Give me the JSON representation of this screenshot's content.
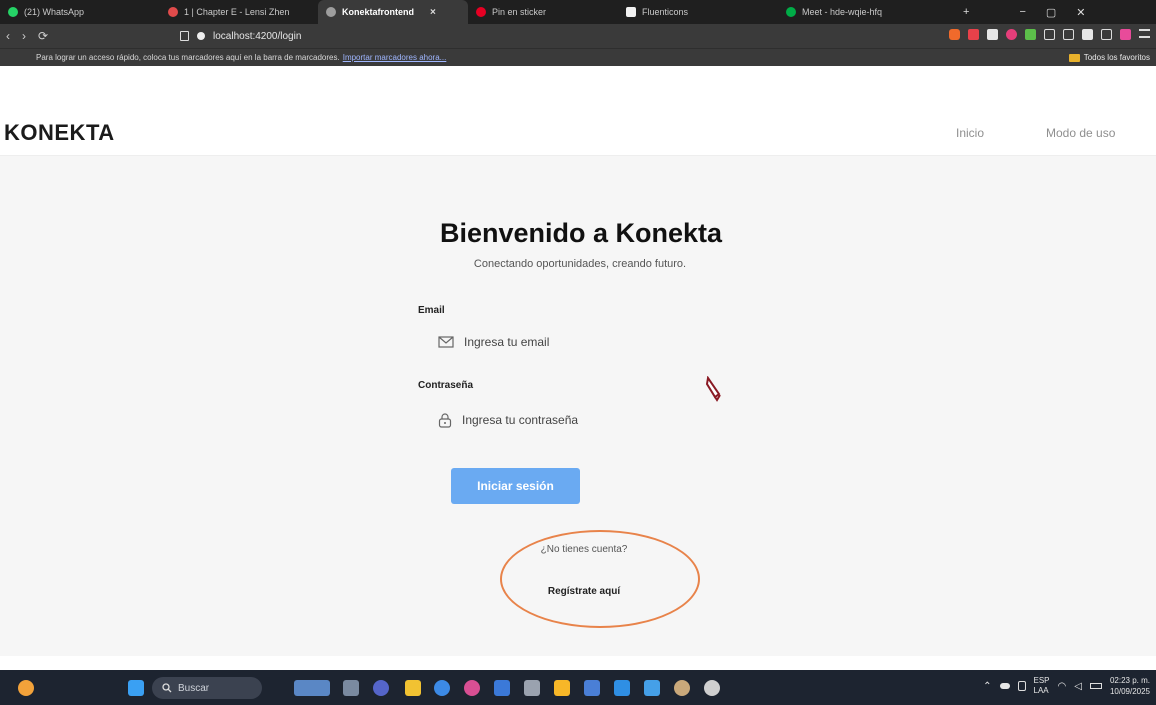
{
  "browser": {
    "tabs": [
      {
        "label": "(21) WhatsApp",
        "color": "#25d366"
      },
      {
        "label": "1 | Chapter E - Lensi Zhen",
        "color": "#e04b4b"
      },
      {
        "label": "Konektafrontend",
        "color": "#9e9e9e",
        "active": true
      },
      {
        "label": "Pin en sticker",
        "color": "#e60023"
      },
      {
        "label": "Fluenticons",
        "color": "#f1f1f1"
      },
      {
        "label": "Meet - hde-wqie-hfq",
        "color": "#00ac47"
      }
    ],
    "tab_close": "×",
    "new_tab": "+",
    "win_min": "−",
    "win_max": "▢",
    "win_close": "✕",
    "nav_back": "‹",
    "nav_forward": "›",
    "nav_reload": "⟳",
    "url": "localhost:4200/login",
    "bookmarks_hint": "Para lograr un acceso rápido, coloca tus marcadores aquí en la barra de marcadores.",
    "bookmarks_import": "Importar marcadores ahora...",
    "bookmarks_all": "Todos los favoritos"
  },
  "app": {
    "logo": "KONEKTA",
    "nav": {
      "inicio": "Inicio",
      "modo_de_uso": "Modo de uso"
    },
    "title": "Bienvenido a Konekta",
    "subtitle": "Conectando oportunidades, creando futuro.",
    "email_label": "Email",
    "email_placeholder": "Ingresa tu email",
    "password_label": "Contraseña",
    "password_placeholder": "Ingresa tu contraseña",
    "login_button": "Iniciar sesión",
    "no_account": "¿No tienes cuenta?",
    "register_link": "Regístrate aquí",
    "accent_color": "#6aaaf2",
    "highlight_color": "#e8834a"
  },
  "taskbar": {
    "search_placeholder": "Buscar",
    "lang_top": "ESP",
    "lang_bottom": "LAA",
    "time": "02:23 p. m.",
    "date": "10/09/2025"
  }
}
